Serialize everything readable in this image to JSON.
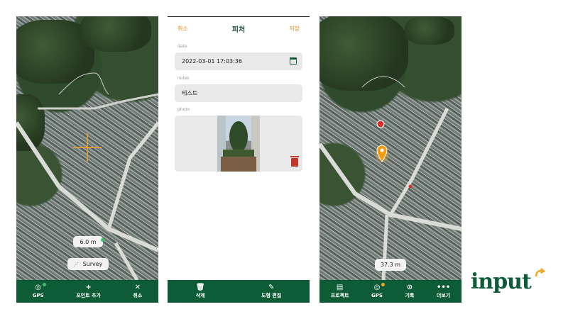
{
  "screen1": {
    "distance": "6.0 m",
    "survey": "Survey",
    "tabs": [
      {
        "icon": "gps-icon",
        "label": "GPS"
      },
      {
        "icon": "plus-icon",
        "label": "포인트 추가"
      },
      {
        "icon": "close-icon",
        "label": "취소"
      }
    ]
  },
  "screen2": {
    "cancel": "취소",
    "title": "피처",
    "save": "저장",
    "date_label": "date",
    "date_value": "2022-03-01 17:03:36",
    "notes_label": "notes",
    "notes_value": "테스트",
    "photo_label": "photo",
    "tabs": [
      {
        "icon": "trash-icon",
        "label": "삭제"
      },
      {
        "icon": "pencil-icon",
        "label": "도형 편집"
      }
    ]
  },
  "screen3": {
    "distance": "37.3 m",
    "tabs": [
      {
        "icon": "map-icon",
        "label": "프로젝트"
      },
      {
        "icon": "gps-icon",
        "label": "GPS"
      },
      {
        "icon": "record-icon",
        "label": "기록"
      },
      {
        "icon": "more-icon",
        "label": "더보기"
      }
    ]
  },
  "brand": {
    "logo": "input",
    "color": "#0d5c36",
    "accent": "#f5a623"
  }
}
